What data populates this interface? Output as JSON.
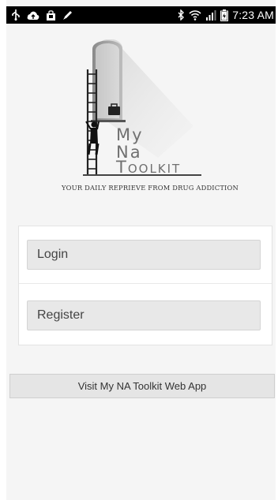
{
  "status_bar": {
    "time": "7:23 AM",
    "left_icons": [
      "usb-icon",
      "cloud-upload-icon",
      "shopping-bag-icon",
      "pencil-icon"
    ],
    "right_icons": [
      "bluetooth-icon",
      "wifi-icon",
      "signal-icon",
      "battery-icon"
    ]
  },
  "logo": {
    "word_my": "My",
    "word_na": "Na",
    "word_toolkit": "Toolkit",
    "tagline": "YOUR DAILY REPRIEVE FROM DRUG ADDICTION"
  },
  "auth": {
    "login_label": "Login",
    "register_label": "Register"
  },
  "links": {
    "web_app_label": "Visit My NA Toolkit Web App"
  },
  "colors": {
    "status_bar": "#000000",
    "background": "#f5f5f5",
    "button_fill": "#e8e8e8",
    "logo_text": "#707070"
  }
}
